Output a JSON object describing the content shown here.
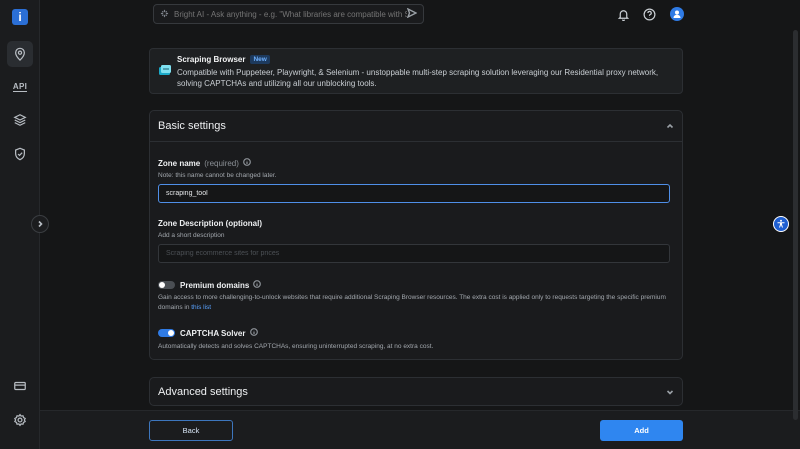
{
  "app": {
    "logo_letter": "i"
  },
  "search": {
    "placeholder": "Bright AI - Ask anything - e.g. \"What libraries are compatible with Scrap"
  },
  "rail": {
    "items": [
      {
        "icon": "location-pin-icon",
        "active": true
      },
      {
        "icon": "api-icon",
        "label": "API"
      },
      {
        "icon": "layers-icon"
      },
      {
        "icon": "shield-check-icon"
      },
      {
        "icon": "billing-card-icon"
      },
      {
        "icon": "settings-gear-icon"
      }
    ]
  },
  "banner": {
    "title": "Scraping Browser",
    "badge": "New",
    "text": "Compatible with Puppeteer, Playwright, & Selenium - unstoppable multi-step scraping solution leveraging our Residential proxy network, solving CAPTCHAs and utilizing all our unblocking tools."
  },
  "basic_settings": {
    "title": "Basic settings",
    "zone_name": {
      "label": "Zone name",
      "required": "(required)",
      "note": "Note: this name cannot be changed later.",
      "value": "scraping_tool"
    },
    "zone_description": {
      "label": "Zone Description (optional)",
      "note": "Add a short description",
      "placeholder": "Scraping ecommerce sites for prices"
    },
    "premium_domains": {
      "label": "Premium domains",
      "enabled": false,
      "desc": "Gain access to more challenging-to-unlock websites that require additional Scraping Browser resources. The extra cost is applied only to requests targeting the specific premium domains in",
      "link": "this list"
    },
    "captcha_solver": {
      "label": "CAPTCHA Solver",
      "enabled": true,
      "desc": "Automatically detects and solves CAPTCHAs, ensuring uninterrupted scraping, at no extra cost."
    }
  },
  "advanced_settings": {
    "title": "Advanced settings"
  },
  "footer": {
    "back_label": "Back",
    "add_label": "Add"
  },
  "colors": {
    "accent": "#2f86f0",
    "background": "#151617",
    "toggle_on": "#2f7be5"
  }
}
